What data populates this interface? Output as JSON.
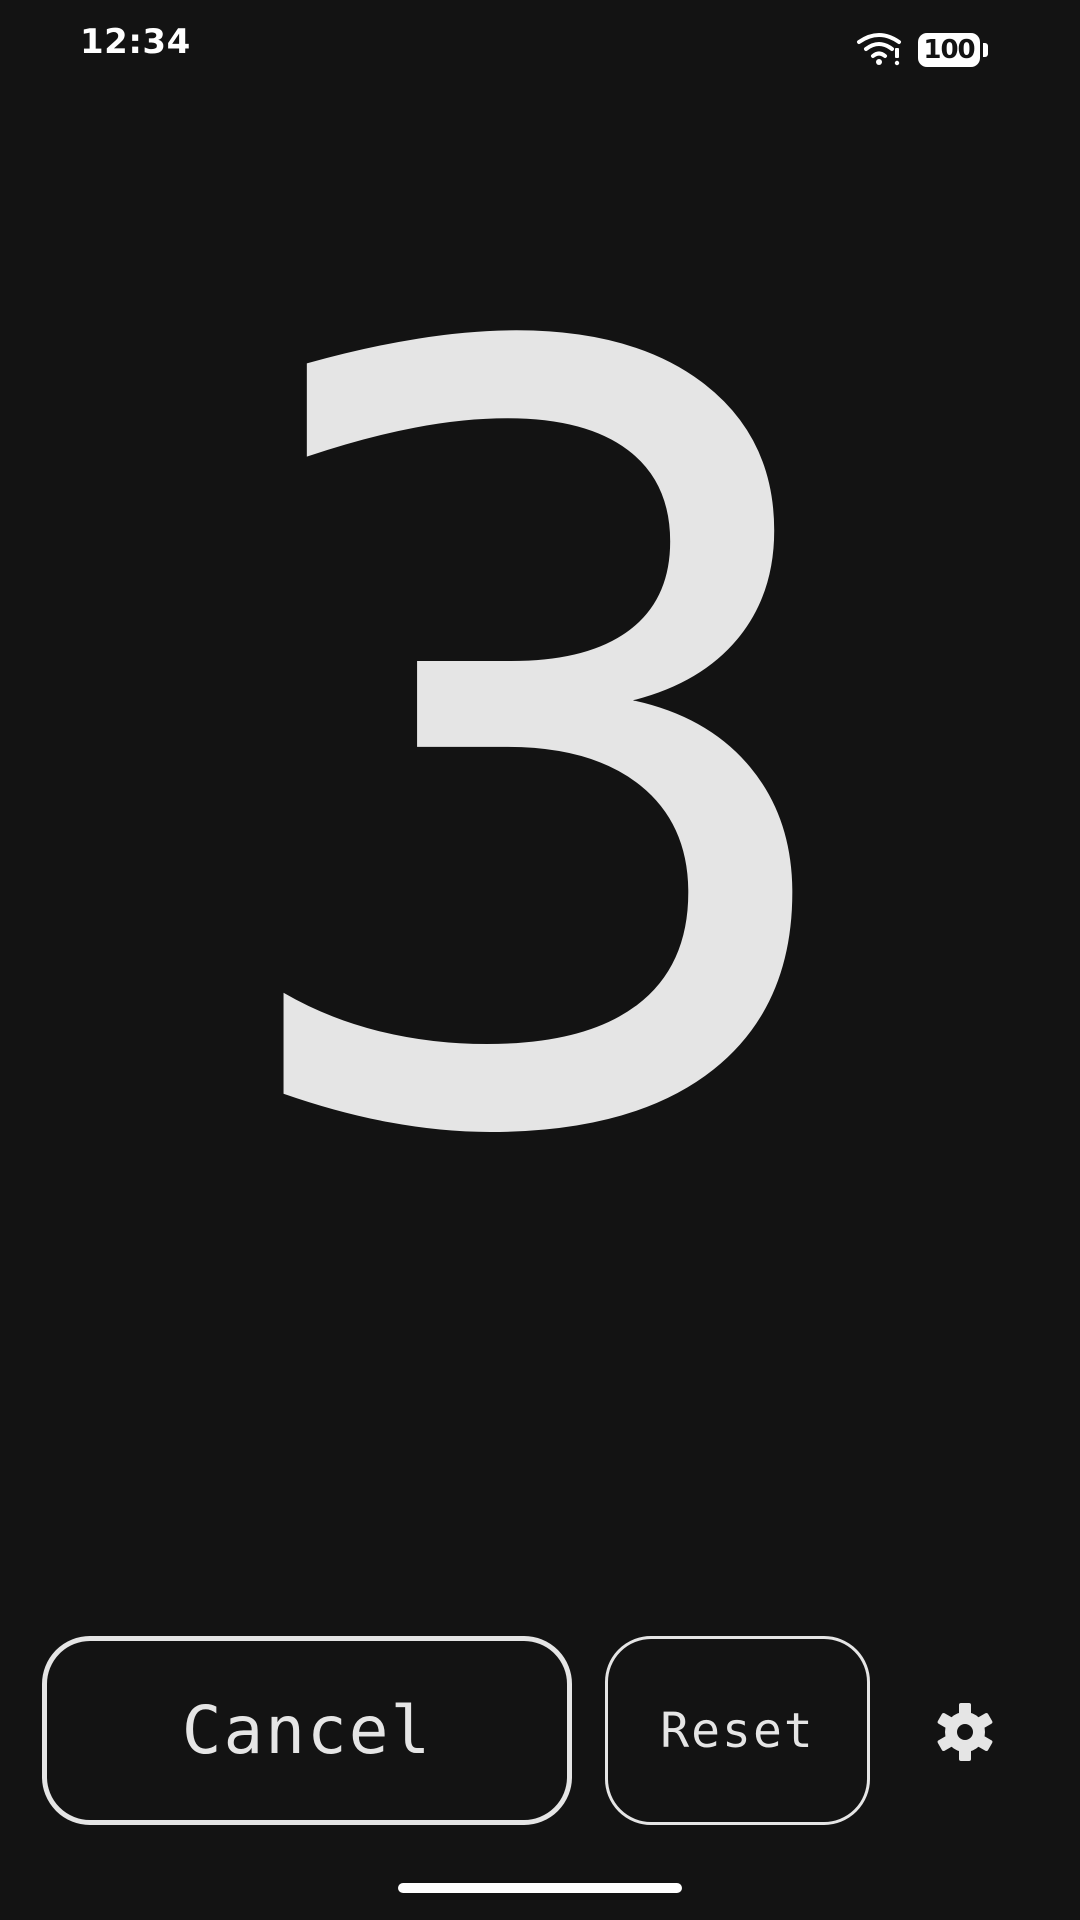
{
  "status_bar": {
    "time": "12:34",
    "battery_level": "100",
    "icons": [
      "wifi-icon",
      "battery-icon"
    ]
  },
  "countdown": {
    "value": "3"
  },
  "buttons": {
    "cancel_label": "Cancel",
    "reset_label": "Reset",
    "settings_icon": "gear-icon"
  },
  "colors": {
    "background": "#131313",
    "foreground": "#e5e5e5",
    "status_text": "#ffffff"
  }
}
